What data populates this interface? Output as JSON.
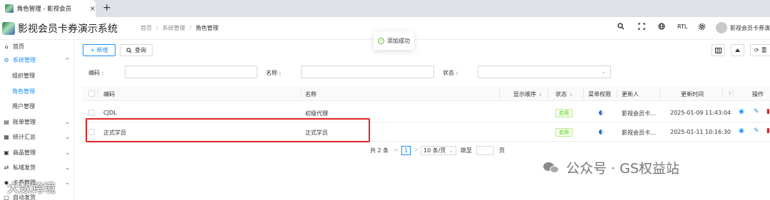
{
  "browser": {
    "tab_title": "角色管理 - 影视会员",
    "close": "×",
    "new_tab": "+"
  },
  "header": {
    "app_title": "影视会员卡券演示系统",
    "breadcrumb": [
      "首页",
      "系统管理",
      "角色管理"
    ],
    "breadcrumb_sep": "/",
    "rtl_label": "RTL",
    "user_name": "影视会员卡券演"
  },
  "sidebar": {
    "items": [
      {
        "label": "首页",
        "icon": "home-icon",
        "glyph": "⌂"
      },
      {
        "label": "系统管理",
        "icon": "gears-icon",
        "glyph": "⚙"
      },
      {
        "label": "组织管理"
      },
      {
        "label": "角色管理"
      },
      {
        "label": "用户管理"
      },
      {
        "label": "账单管理",
        "icon": "bill-icon",
        "glyph": "▤"
      },
      {
        "label": "统计汇总",
        "icon": "chart-icon",
        "glyph": "▦"
      },
      {
        "label": "商品管理",
        "icon": "goods-icon",
        "glyph": "▣"
      },
      {
        "label": "私域发货",
        "icon": "shuffle-icon",
        "glyph": "⇄"
      },
      {
        "label": "卡券管理",
        "icon": "card-icon",
        "glyph": "◆"
      },
      {
        "label": "自动发货",
        "icon": "auto-icon",
        "glyph": "▢"
      }
    ]
  },
  "toolbar": {
    "add_label": "+ 新增",
    "query_label": "查询",
    "reset_label": "重"
  },
  "toast": {
    "message": "添加成功"
  },
  "filters": {
    "code_label": "编码 :",
    "name_label": "名称 :",
    "status_label": "状态 :"
  },
  "table": {
    "columns": [
      "编码",
      "名称",
      "显示顺序",
      "状态",
      "菜单权限",
      "更新人",
      "更新时间",
      "操作"
    ],
    "rows": [
      {
        "code": "CJDL",
        "name": "初级代理",
        "status": "启用",
        "updater": "影视会员卡...",
        "updated_at": "2025-01-09 11:43:04"
      },
      {
        "code": "正式学员",
        "name": "正式学员",
        "status": "启用",
        "updater": "影视会员卡...",
        "updated_at": "2025-01-11 10:16:30"
      }
    ]
  },
  "pagination": {
    "total": "共 2 条",
    "prev": "<",
    "current": "1",
    "next": ">",
    "page_size": "10 条/页",
    "jump_label": "跳至",
    "page_unit": "页"
  },
  "watermarks": {
    "wechat_text": "公众号 · GS权益站",
    "corner_text": "大数跨境"
  },
  "colors": {
    "accent": "#1890ff",
    "success": "#52c41a",
    "highlight_border": "#e02424"
  }
}
